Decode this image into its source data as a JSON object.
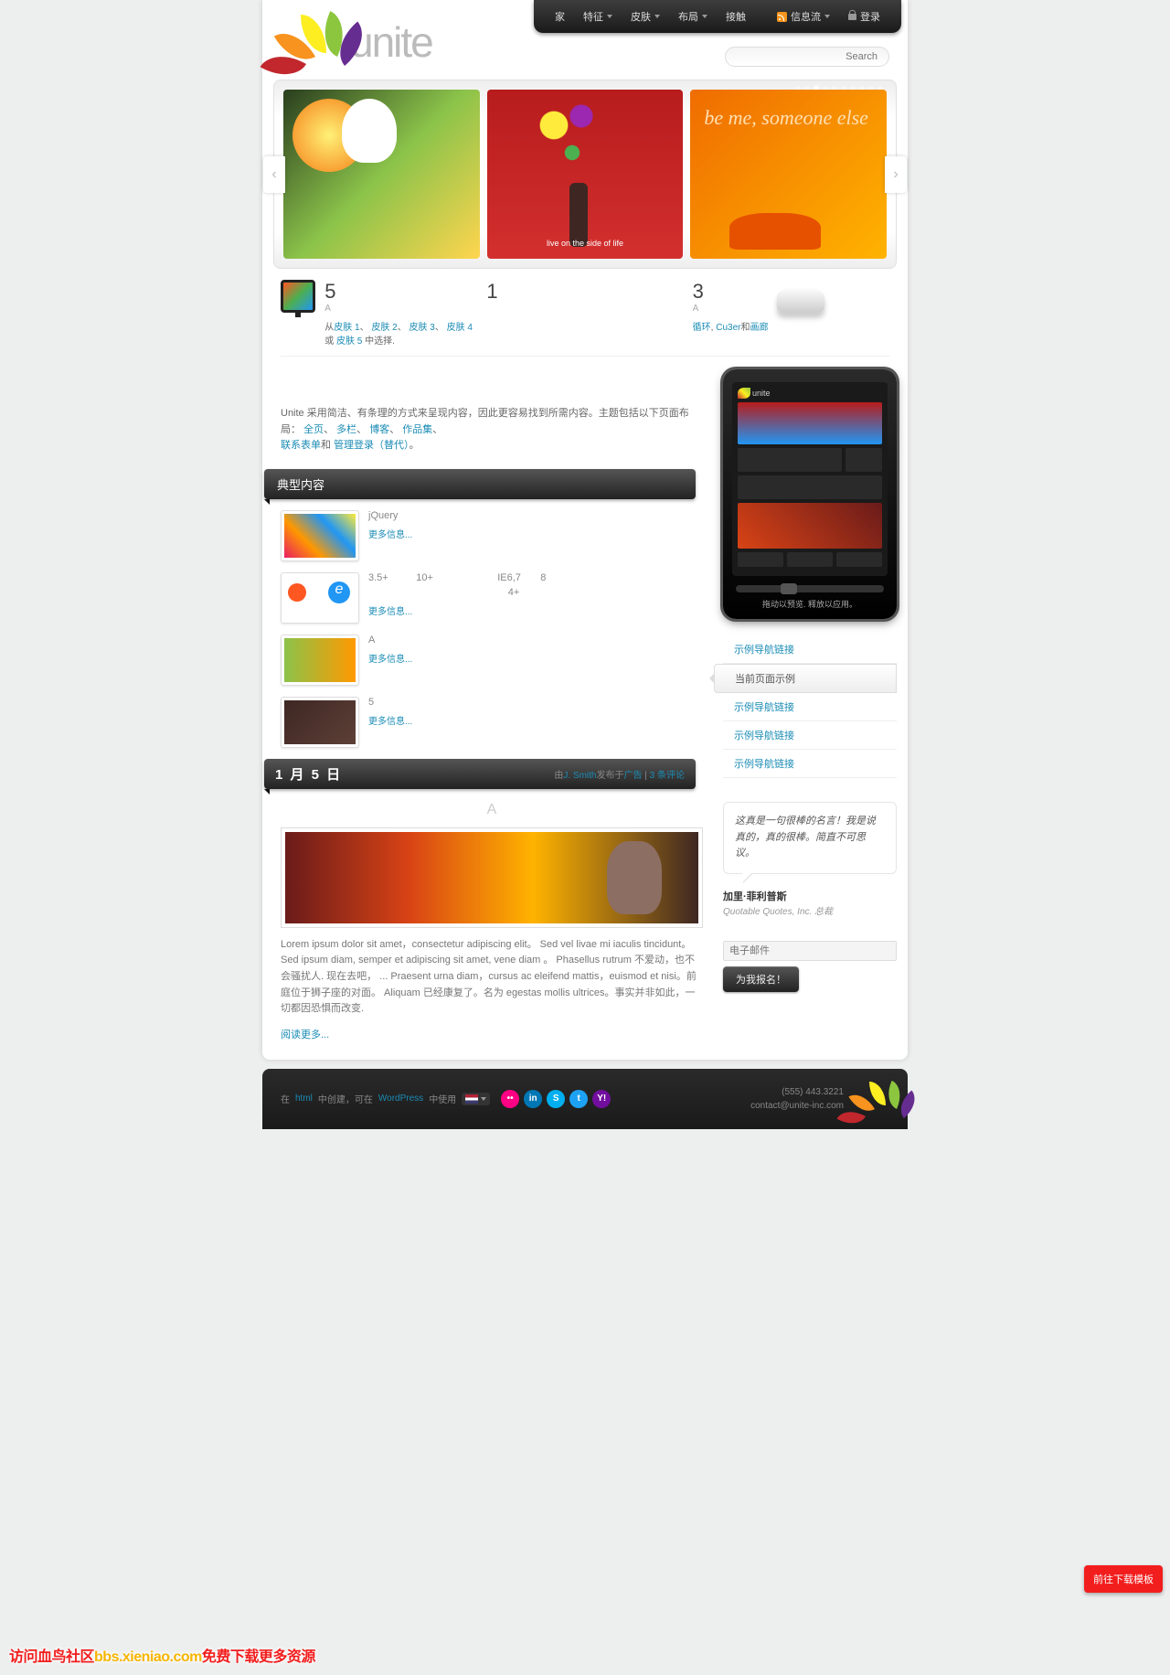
{
  "nav": {
    "home": "家",
    "features": "特征",
    "skins": "皮肤",
    "layout": "布局",
    "contact": "接触",
    "feed": "信息流",
    "login": "登录"
  },
  "brand": "unite",
  "search": {
    "placeholder": "Search"
  },
  "slide2": {
    "tag": "live on the        side of life"
  },
  "slide3": {
    "line": "be me, someone else"
  },
  "featA": {
    "num": "5",
    "sub": "A",
    "prefix": "从",
    "s1": "皮肤 1",
    "s2": "皮肤 2",
    "s3": "皮肤 3",
    "s4": "皮肤 4",
    "or": "或",
    "s5": "皮肤 5",
    "suffix": "中选择."
  },
  "featB": {
    "num": "1"
  },
  "featC": {
    "num": "3",
    "sub": "A",
    "l1": "循环",
    "sep": ", ",
    "l2": "Cu3er",
    "and": "和",
    "l3": "画廊"
  },
  "intro": {
    "t1": "Unite 采用简洁、有条理的方式来呈现内容，因此更容易找到所需内容。主题包括以下页面布局：",
    "l1": "全页",
    "c": "、",
    "l2": "多栏",
    "l3": "博客",
    "l4": "作品集",
    "l5": "联系表单",
    "and": "和",
    "l6": "管理登录（替代）",
    "end": "。"
  },
  "ribbon1": "典型内容",
  "typ": [
    {
      "title": "jQuery",
      "line2": "",
      "more": "更多信息..."
    },
    {
      "title": "3.5+          10+                       IE6,7       8",
      "line2": "                                                  4+",
      "more": "更多信息..."
    },
    {
      "title": "A",
      "line2": "",
      "more": "更多信息..."
    },
    {
      "title": "5",
      "line2": "",
      "more": "更多信息..."
    }
  ],
  "post": {
    "date": "1 月 5 日",
    "by": "由",
    "author": "J. Smith",
    "pub": "发布于",
    "cat": "广告",
    "sep": " | ",
    "comments": "3 条评论",
    "title": "A",
    "body": "Lorem ipsum dolor sit amet，consectetur adipiscing elit。 Sed vel livae mi iaculis tincidunt。Sed ipsum diam, semper et adipiscing sit amet, vene diam 。 Phasellus rutrum 不爱动，也不会骚扰人. 现在去吧，  ... Praesent urna diam，cursus ac eleifend mattis，euismod et nisi。前庭位于狮子座的对面。 Aliquam 已经康复了。名为 egestas mollis ultrices。事实并非如此，一切都因恐惧而改变.",
    "readmore": "阅读更多..."
  },
  "phone": {
    "caption": "拖动以预览. 释放以应用。"
  },
  "subnav": {
    "i1": "示例导航链接",
    "i2": "当前页面示例",
    "i3": "示例导航链接",
    "i4": "示例导航链接",
    "i5": "示例导航链接"
  },
  "quote": {
    "text": "这真是一句很棒的名言！我是说真的，真的很棒。简直不可思议。",
    "author": "加里·菲利普斯",
    "role": "Quotable Quotes, Inc. 总裁"
  },
  "email": {
    "placeholder": "电子邮件"
  },
  "signup": "为我报名！",
  "footer": {
    "text_pre": "在",
    "text_link": "html",
    "text_mid": "中创建，可在",
    "text_link2": "WordPress",
    "text_post": "中使用",
    "phone": "(555) 443.3221",
    "email": "contact@unite-inc.com"
  },
  "download_btn": "前往下载模板",
  "watermark": {
    "t1": "访问血鸟社区",
    "t2": "bbs.xieniao.com",
    "t3": "免费下载更多资源"
  }
}
